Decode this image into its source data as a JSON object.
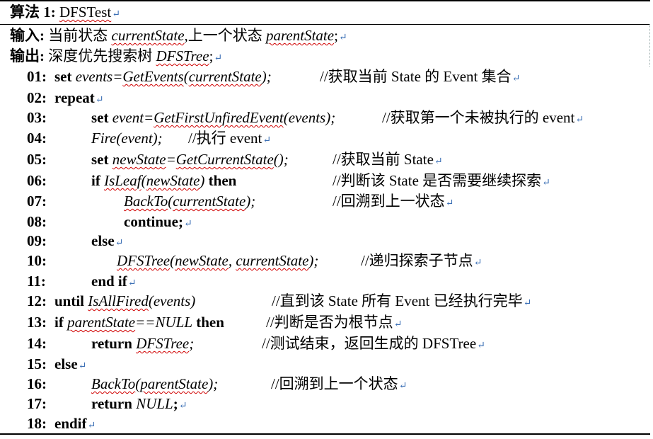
{
  "title": {
    "label": "算法",
    "number": "1:",
    "name": "DFSTest"
  },
  "input": {
    "label": "输入:",
    "text1": "当前状态",
    "var1": "currentState",
    "text2": ",上一个状态",
    "var2": "parentState",
    "end": ";"
  },
  "output": {
    "label": "输出:",
    "text": "深度优先搜索树",
    "var": "DFSTree",
    "end": ";"
  },
  "paragraph_mark": "↵",
  "lines": {
    "l01": {
      "num": "01:",
      "kw": "set",
      "a": "events=",
      "b": "GetEvents",
      "c": "(",
      "d": "currentState",
      "e": ");",
      "comment": "//获取当前 State 的 Event 集合"
    },
    "l02": {
      "num": "02:",
      "kw": "repeat"
    },
    "l03": {
      "num": "03:",
      "kw": "set",
      "a": "event=",
      "b": "GetFirstUnfiredEvent",
      "c": "(events);",
      "comment": "//获取第一个未被执行的 event"
    },
    "l04": {
      "num": "04:",
      "a": "Fire(event);",
      "comment": "//执行 event"
    },
    "l05": {
      "num": "05:",
      "kw": "set",
      "a": "newState",
      "b": "=",
      "c": "GetCurrentState",
      "d": "();",
      "comment": "//获取当前 State"
    },
    "l06": {
      "num": "06:",
      "kw": "if",
      "a": "IsLeaf",
      "b": "(",
      "c": "newState",
      "d": ")",
      "kw2": "then",
      "comment": "//判断该 State 是否需要继续探索"
    },
    "l07": {
      "num": "07:",
      "a": "BackTo",
      "b": "(",
      "c": "currentState",
      "d": ");",
      "comment": "//回溯到上一状态"
    },
    "l08": {
      "num": "08:",
      "kw": "continue",
      "e": ";"
    },
    "l09": {
      "num": "09:",
      "kw": "else"
    },
    "l10": {
      "num": "10:",
      "a": "DFSTree",
      "b": "(",
      "c": "newState",
      "d": ", ",
      "e": "currentState",
      "f": ");",
      "comment": "//递归探索子节点"
    },
    "l11": {
      "num": "11:",
      "kw": "end if"
    },
    "l12": {
      "num": "12:",
      "kw": "until",
      "a": "IsAllFired",
      "b": "(events)",
      "comment": "//直到该 State 所有 Event 已经执行完毕"
    },
    "l13": {
      "num": "13:",
      "kw": "if",
      "a": "parentState",
      "b": "==NULL",
      "kw2": "then",
      "comment": "//判断是否为根节点"
    },
    "l14": {
      "num": "14:",
      "kw": "return",
      "a": "DFSTree",
      "b": ";",
      "comment": "//测试结束，返回生成的 DFSTree"
    },
    "l15": {
      "num": "15:",
      "kw": "else"
    },
    "l16": {
      "num": "16:",
      "a": "BackTo",
      "b": "(",
      "c": "parentState",
      "d": ");",
      "comment": "//回溯到上一个状态"
    },
    "l17": {
      "num": "17:",
      "kw": "return",
      "a": "NULL",
      "b": ";"
    },
    "l18": {
      "num": "18:",
      "kw": "endif"
    }
  }
}
